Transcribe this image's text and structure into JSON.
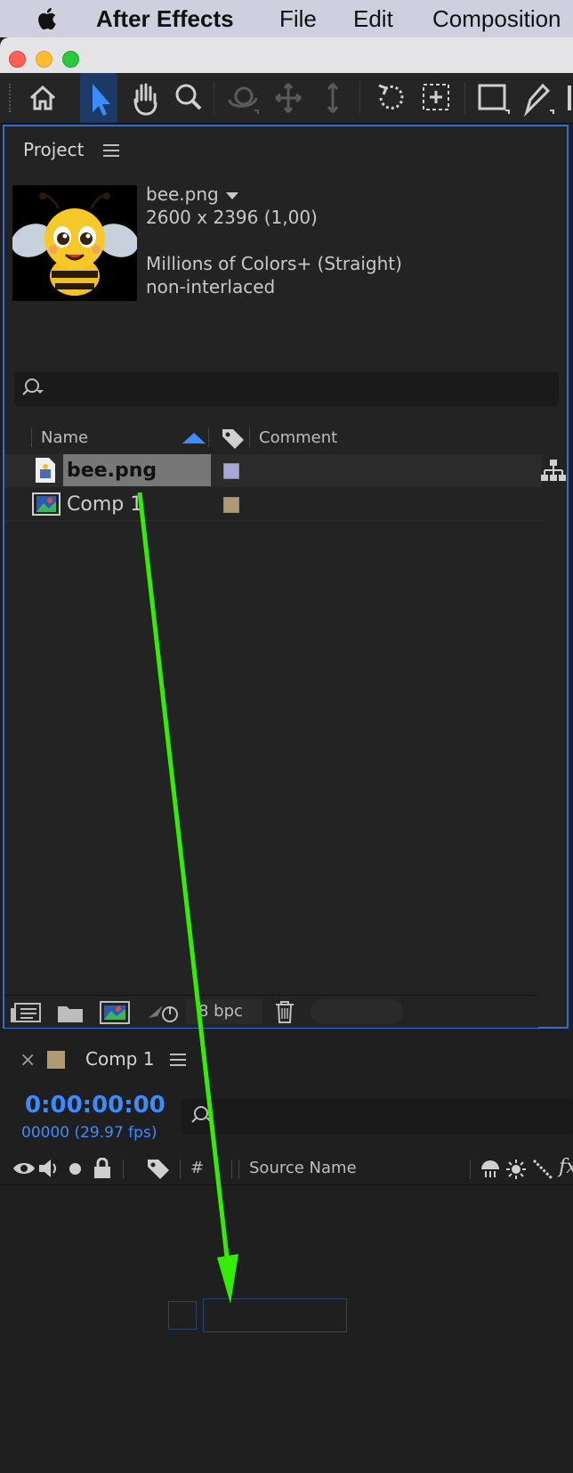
{
  "menubar": {
    "app": "After Effects",
    "items": [
      "File",
      "Edit",
      "Composition"
    ]
  },
  "colors": {
    "accent": "#2d6fd6",
    "timecode": "#3d8cff",
    "arrow": "#33ee00",
    "label_lavender": "#a8a8d8",
    "label_tan": "#b09a74"
  },
  "toolbar": {
    "tools": [
      "home-icon",
      "selection-tool-icon",
      "hand-tool-icon",
      "zoom-tool-icon",
      "orbit-camera-icon",
      "pan-camera-icon",
      "dolly-camera-icon",
      "rotate-tool-icon",
      "anchor-point-tool-icon",
      "rectangle-tool-icon",
      "pen-tool-icon"
    ]
  },
  "project": {
    "title": "Project",
    "selected": {
      "name": "bee.png",
      "dimensions": "2600 x 2396 (1,00)",
      "color_info": "Millions of Colors+ (Straight)",
      "interlace": "non-interlaced"
    },
    "columns": {
      "name": "Name",
      "comment": "Comment"
    },
    "items": [
      {
        "name": "bee.png",
        "label_color": "#a8a8d8"
      },
      {
        "name": "Comp 1",
        "label_color": "#b09a74"
      }
    ],
    "footer": {
      "bpc": "8 bpc"
    }
  },
  "comp": {
    "tab": "Comp 1",
    "close": "×",
    "timecode": "0:00:00:00",
    "fps": "00000 (29.97 fps)",
    "columns": {
      "number": "#",
      "source_name": "Source Name"
    }
  }
}
